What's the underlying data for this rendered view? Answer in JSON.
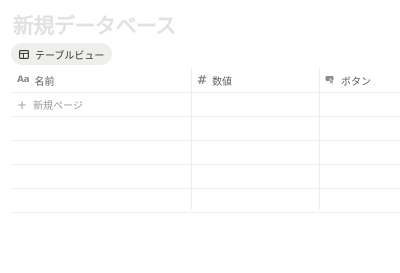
{
  "database": {
    "title": "新規データベース"
  },
  "view_tab": {
    "label": "テーブルビュー",
    "icon": "table-icon"
  },
  "table": {
    "columns": [
      {
        "label": "名前",
        "icon": "text-icon",
        "icon_glyph": "Aa"
      },
      {
        "label": "数値",
        "icon": "number-icon",
        "icon_glyph": "#"
      },
      {
        "label": "ボタン",
        "icon": "button-cursor-icon"
      }
    ],
    "new_page_label": "新規ページ",
    "empty_rows": 4
  }
}
